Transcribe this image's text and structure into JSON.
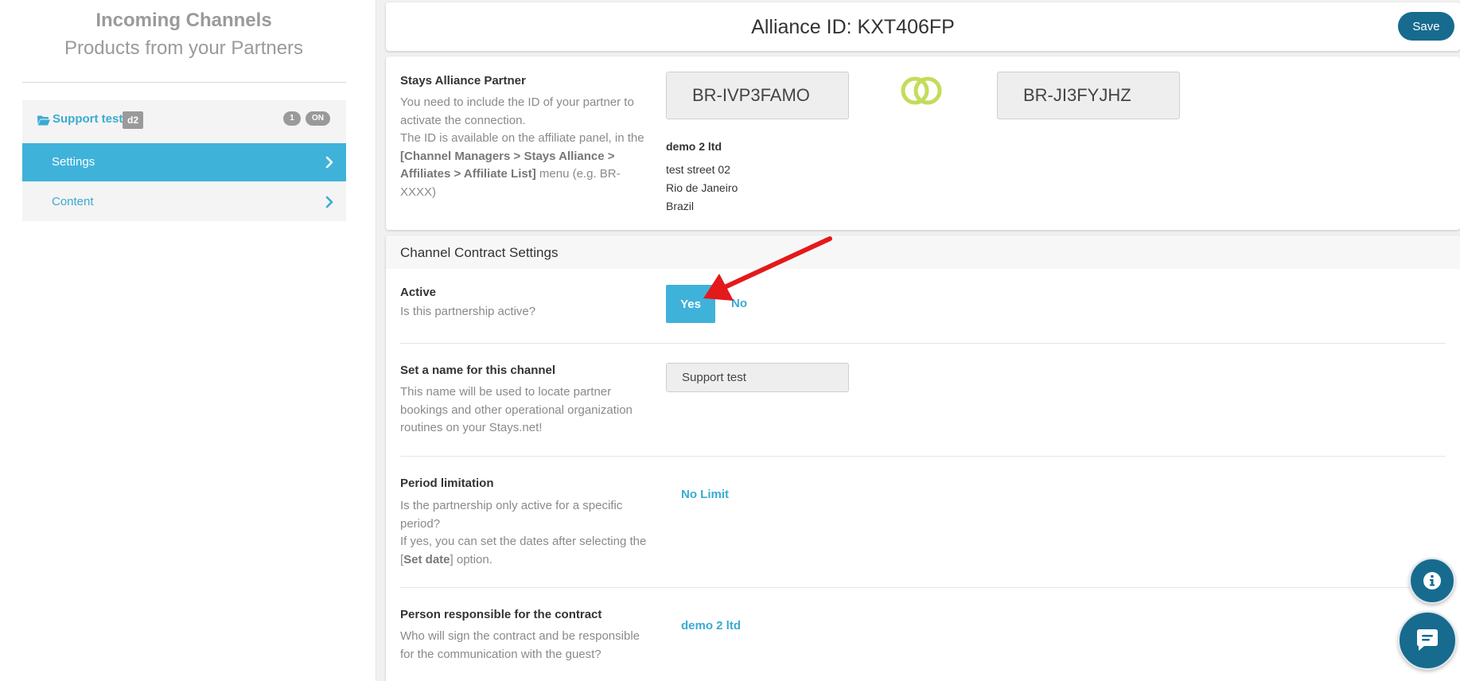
{
  "sidebar": {
    "title": "Incoming Channels",
    "subtitle": "Products from your Partners",
    "channel": {
      "name": "Support test",
      "tag": "d2",
      "count": "1",
      "status": "ON"
    },
    "nav": [
      {
        "label": "Settings",
        "active": true
      },
      {
        "label": "Content",
        "active": false
      }
    ]
  },
  "header": {
    "title": "Alliance ID: KXT406FP",
    "save_label": "Save"
  },
  "partner": {
    "title": "Stays Alliance Partner",
    "desc_line1": "You need to include the ID of your partner to",
    "desc_line2": "activate the connection.",
    "desc_line3": "The ID is available on the affiliate panel, in the",
    "desc_bold1": "[Channel Managers > Stays Alliance >",
    "desc_bold2": "Affiliates > Affiliate List]",
    "desc_tail": " menu (e.g. BR-XXXX)",
    "own_id": "BR-IVP3FAMO",
    "partner_id": "BR-JI3FYJHZ",
    "company": "demo 2 ltd",
    "address": [
      "test street 02",
      "Rio de Janeiro",
      "Brazil"
    ]
  },
  "contract": {
    "title": "Channel Contract Settings",
    "active": {
      "label": "Active",
      "desc": "Is this partnership active?",
      "yes": "Yes",
      "no": "No"
    },
    "name": {
      "label": "Set a name for this channel",
      "desc_line1": "This name will be used to locate partner",
      "desc_line2": "bookings and other operational organization",
      "desc_line3": "routines on your Stays.net!",
      "value": "Support test"
    },
    "period": {
      "label": "Period limitation",
      "desc_line1": "Is the partnership only active for a specific",
      "desc_line2": "period?",
      "desc_line3": "If yes, you can set the dates after selecting the",
      "desc_pre": "[",
      "desc_bold": "Set date",
      "desc_post": "] option.",
      "value": "No Limit"
    },
    "person": {
      "label": "Person responsible for the contract",
      "desc_line1": "Who will sign the contract and be responsible",
      "desc_line2": "for the communication with the guest?",
      "value": "demo 2 ltd"
    }
  },
  "colors": {
    "accent": "#3fb2da",
    "link": "#3aabd2",
    "primary_dark": "#176b8f",
    "rings": "#c3dc5a",
    "arrow": "#e3191b"
  },
  "icons": [
    "folder-open-icon",
    "chevron-right-icon",
    "linked-rings-icon",
    "info-icon",
    "chat-icon"
  ]
}
